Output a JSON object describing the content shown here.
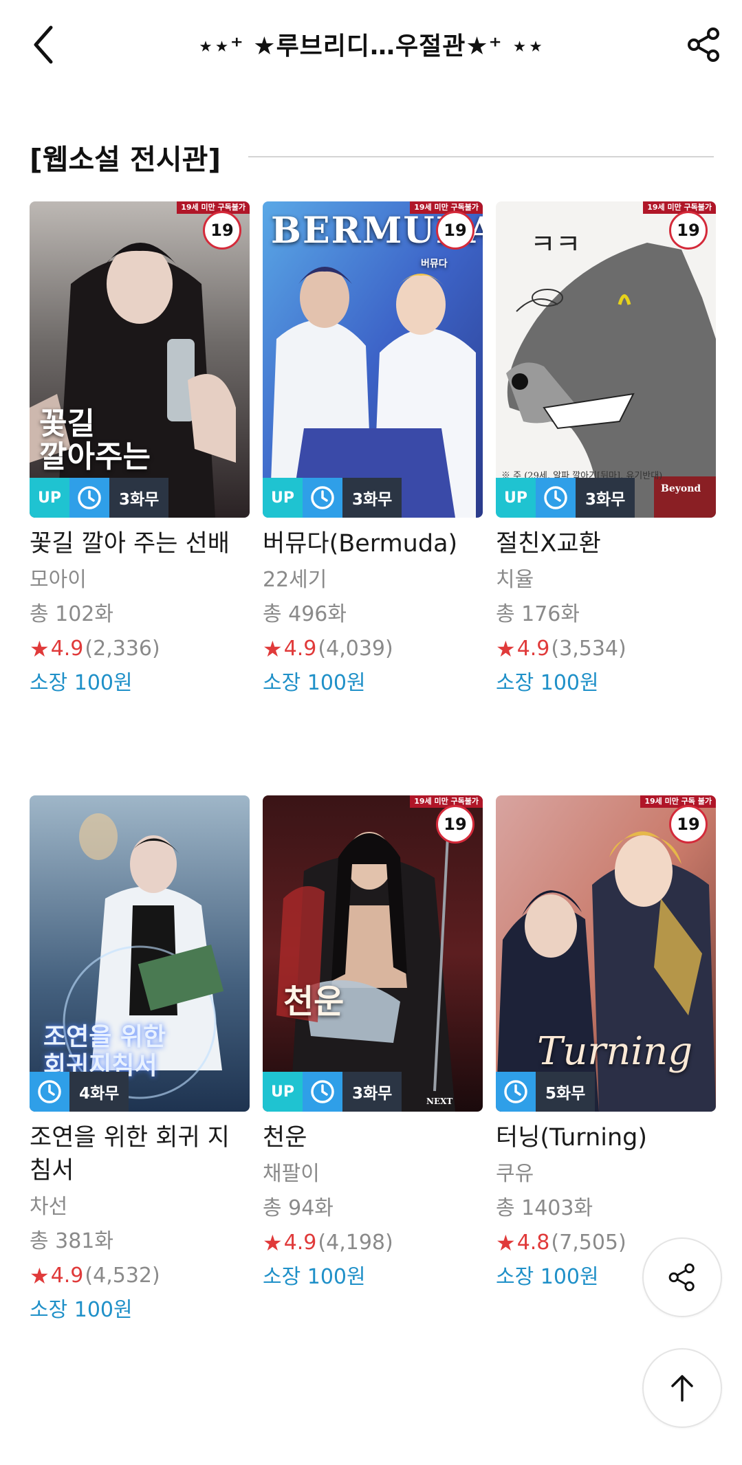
{
  "header": {
    "title": "⋆⋆⁺ ★루브리디…우절관★⁺ ⋆⋆",
    "back_icon": "chevron-left-icon",
    "share_icon": "share-icon"
  },
  "section": {
    "title": "[웹소설 전시관]"
  },
  "colors": {
    "accent_blue": "#1f90c8",
    "star_red": "#e03a3a",
    "up_badge": "#1fc3d1",
    "clock_badge": "#2f9fe8",
    "free_badge": "#2b3544",
    "age_red": "#d42a3a"
  },
  "books": [
    {
      "title": "꽃길 깔아 주는 선배",
      "author": "모아이",
      "episodes": "총 102화",
      "rating": "4.9",
      "reviews": "(2,336)",
      "price": "소장 100원",
      "up": "UP",
      "free": "3화무",
      "age": "19",
      "age_notice": "19세 미만 구독불가",
      "cover_text": "꽃길\n깔아주는"
    },
    {
      "title": "버뮤다(Bermuda)",
      "author": "22세기",
      "episodes": "총 496화",
      "rating": "4.9",
      "reviews": "(4,039)",
      "price": "소장 100원",
      "up": "UP",
      "free": "3화무",
      "age": "19",
      "age_notice": "19세 미만 구독불가",
      "cover_text": "BERMUDA",
      "cover_sub": "버뮤다"
    },
    {
      "title": "절친X교환",
      "author": "치율",
      "episodes": "총 176화",
      "rating": "4.9",
      "reviews": "(3,534)",
      "price": "소장 100원",
      "up": "UP",
      "free": "3화무",
      "age": "19",
      "age_notice": "19세 미만 구독불가",
      "cover_text": "ㅋㅋ",
      "cover_sub": "※ 주 (29세, 알파 깔아기[뒤마], 유기반대)",
      "publisher": "Beyond"
    },
    {
      "title": "조연을 위한 회귀 지침서",
      "author": "차선",
      "episodes": "총 381화",
      "rating": "4.9",
      "reviews": "(4,532)",
      "price": "소장 100원",
      "free": "4화무",
      "cover_text": "조연을 위한\n회귀지침서"
    },
    {
      "title": "천운",
      "author": "채팔이",
      "episodes": "총 94화",
      "rating": "4.9",
      "reviews": "(4,198)",
      "price": "소장 100원",
      "up": "UP",
      "free": "3화무",
      "age": "19",
      "age_notice": "19세 미만 구독불가",
      "cover_text": "천운",
      "publisher": "NEXT"
    },
    {
      "title": "터닝(Turning)",
      "author": "쿠유",
      "episodes": "총 1403화",
      "rating": "4.8",
      "reviews": "(7,505)",
      "price": "소장 100원",
      "free": "5화무",
      "age": "19",
      "age_notice": "19세 미만 구독 불가",
      "cover_text": "Turning"
    }
  ],
  "fab": {
    "share_icon": "share-icon",
    "top_icon": "arrow-up-icon"
  }
}
